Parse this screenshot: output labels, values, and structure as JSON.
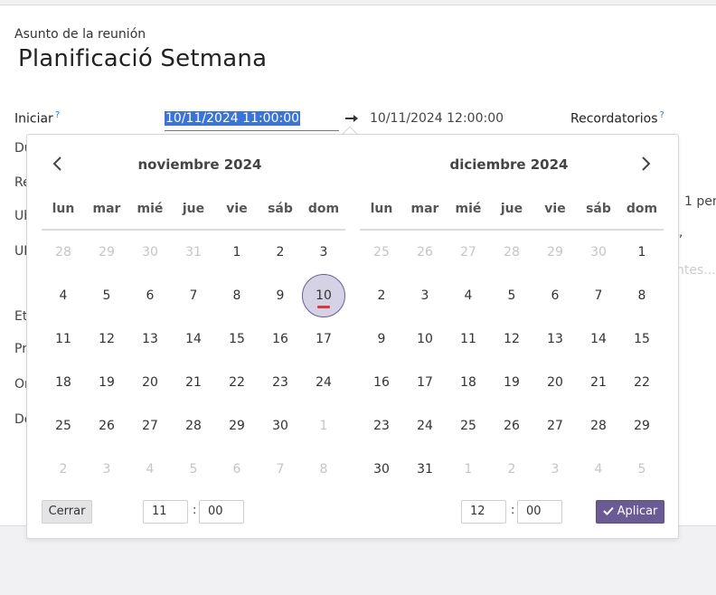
{
  "form": {
    "subject_label": "Asunto de la reunión",
    "subject_value": "Planificació Setmana",
    "start_label": "Iniciar",
    "help_mark": "?",
    "start_value": "10/11/2024 11:00:00",
    "end_value": "10/11/2024 12:00:00",
    "reminders_label": "Recordatorios",
    "hidden_fragments": [
      "Du",
      "Re",
      "Ub",
      "UR",
      "Et",
      "Pr",
      "Or",
      "De",
      "1 pen",
      "”",
      "ntes..."
    ]
  },
  "picker": {
    "left_month": "noviembre 2024",
    "right_month": "diciembre 2024",
    "weekdays": [
      "lun",
      "mar",
      "mié",
      "jue",
      "vie",
      "sáb",
      "dom"
    ],
    "left_weeks": [
      [
        [
          "28",
          0
        ],
        [
          "29",
          0
        ],
        [
          "30",
          0
        ],
        [
          "31",
          0
        ],
        [
          "1",
          1
        ],
        [
          "2",
          1
        ],
        [
          "3",
          1
        ]
      ],
      [
        [
          "4",
          1
        ],
        [
          "5",
          1
        ],
        [
          "6",
          1
        ],
        [
          "7",
          1
        ],
        [
          "8",
          1
        ],
        [
          "9",
          1
        ],
        [
          "10",
          2
        ]
      ],
      [
        [
          "11",
          1
        ],
        [
          "12",
          1
        ],
        [
          "13",
          1
        ],
        [
          "14",
          1
        ],
        [
          "15",
          1
        ],
        [
          "16",
          1
        ],
        [
          "17",
          1
        ]
      ],
      [
        [
          "18",
          1
        ],
        [
          "19",
          1
        ],
        [
          "20",
          1
        ],
        [
          "21",
          1
        ],
        [
          "22",
          1
        ],
        [
          "23",
          1
        ],
        [
          "24",
          1
        ]
      ],
      [
        [
          "25",
          1
        ],
        [
          "26",
          1
        ],
        [
          "27",
          1
        ],
        [
          "28",
          1
        ],
        [
          "29",
          1
        ],
        [
          "30",
          1
        ],
        [
          "1",
          0
        ]
      ],
      [
        [
          "2",
          0
        ],
        [
          "3",
          0
        ],
        [
          "4",
          0
        ],
        [
          "5",
          0
        ],
        [
          "6",
          0
        ],
        [
          "7",
          0
        ],
        [
          "8",
          0
        ]
      ]
    ],
    "right_weeks": [
      [
        [
          "25",
          0
        ],
        [
          "26",
          0
        ],
        [
          "27",
          0
        ],
        [
          "28",
          0
        ],
        [
          "29",
          0
        ],
        [
          "30",
          0
        ],
        [
          "1",
          1
        ]
      ],
      [
        [
          "2",
          1
        ],
        [
          "3",
          1
        ],
        [
          "4",
          1
        ],
        [
          "5",
          1
        ],
        [
          "6",
          1
        ],
        [
          "7",
          1
        ],
        [
          "8",
          1
        ]
      ],
      [
        [
          "9",
          1
        ],
        [
          "10",
          1
        ],
        [
          "11",
          1
        ],
        [
          "12",
          1
        ],
        [
          "13",
          1
        ],
        [
          "14",
          1
        ],
        [
          "15",
          1
        ]
      ],
      [
        [
          "16",
          1
        ],
        [
          "17",
          1
        ],
        [
          "18",
          1
        ],
        [
          "19",
          1
        ],
        [
          "20",
          1
        ],
        [
          "21",
          1
        ],
        [
          "22",
          1
        ]
      ],
      [
        [
          "23",
          1
        ],
        [
          "24",
          1
        ],
        [
          "25",
          1
        ],
        [
          "26",
          1
        ],
        [
          "27",
          1
        ],
        [
          "28",
          1
        ],
        [
          "29",
          1
        ]
      ],
      [
        [
          "30",
          1
        ],
        [
          "31",
          1
        ],
        [
          "1",
          0
        ],
        [
          "2",
          0
        ],
        [
          "3",
          0
        ],
        [
          "4",
          0
        ],
        [
          "5",
          0
        ]
      ]
    ],
    "close_label": "Cerrar",
    "apply_label": "Aplicar",
    "start_hour": "11",
    "start_minute": "00",
    "end_hour": "12",
    "end_minute": "00",
    "time_separator": ":",
    "accent_color": "#6b5b95",
    "today_marker_color": "#e3343e"
  }
}
